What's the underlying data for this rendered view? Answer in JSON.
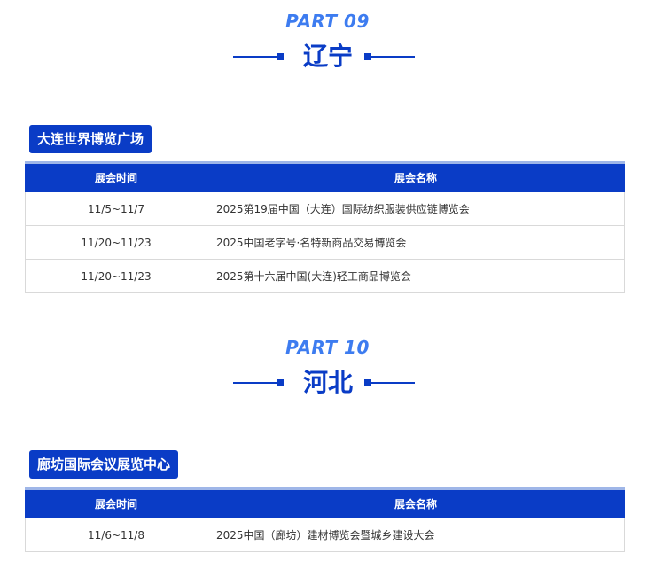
{
  "sections": [
    {
      "part_label": "PART 09",
      "region": "辽宁",
      "venue": "大连世界博览广场",
      "table": {
        "headers": [
          "展会时间",
          "展会名称"
        ],
        "rows": [
          {
            "time": "11/5~11/7",
            "name": "2025第19届中国（大连）国际纺织服装供应链博览会"
          },
          {
            "time": "11/20~11/23",
            "name": "2025中国老字号·名特新商品交易博览会"
          },
          {
            "time": "11/20~11/23",
            "name": "2025第十六届中国(大连)轻工商品博览会"
          }
        ]
      }
    },
    {
      "part_label": "PART 10",
      "region": "河北",
      "venue": "廊坊国际会议展览中心",
      "table": {
        "headers": [
          "展会时间",
          "展会名称"
        ],
        "rows": [
          {
            "time": "11/6~11/8",
            "name": "2025中国（廊坊）建材博览会暨城乡建设大会"
          }
        ]
      }
    }
  ],
  "colors": {
    "accent": "#0a3cc6",
    "part_label": "#3d7cf0"
  }
}
